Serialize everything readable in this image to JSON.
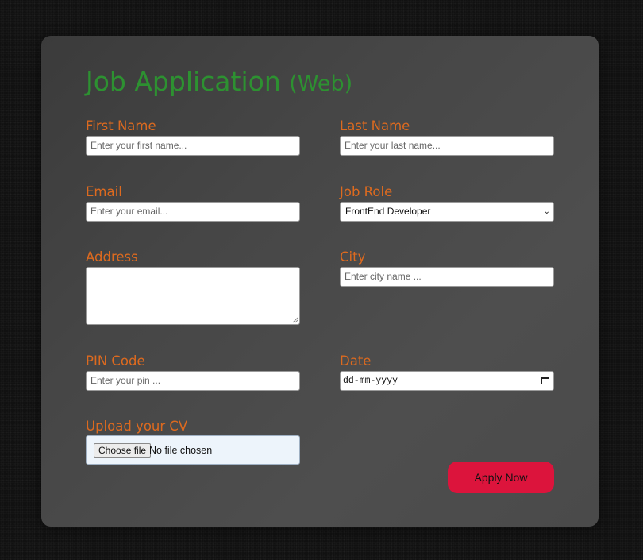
{
  "form": {
    "title": "Job Application",
    "title_suffix": "(Web)",
    "first_name": {
      "label": "First Name",
      "placeholder": "Enter your first name..."
    },
    "last_name": {
      "label": "Last Name",
      "placeholder": "Enter your last name..."
    },
    "email": {
      "label": "Email",
      "placeholder": "Enter your email..."
    },
    "job_role": {
      "label": "Job Role",
      "selected": "FrontEnd Developer"
    },
    "address": {
      "label": "Address",
      "value": ""
    },
    "city": {
      "label": "City",
      "placeholder": "Enter city name ..."
    },
    "pin_code": {
      "label": "PIN Code",
      "placeholder": "Enter your pin ..."
    },
    "date": {
      "label": "Date",
      "placeholder": "dd-mm-yyyy"
    },
    "upload": {
      "label": "Upload your CV",
      "button": "Choose file",
      "status": "No file chosen"
    },
    "apply_button": "Apply Now"
  },
  "colors": {
    "title": "#2d9131",
    "labels": "#dd6a1f",
    "apply_button": "#dc143c",
    "upload_bg": "#edf4fb"
  },
  "icons": {
    "select_arrow": "chevron-down-icon",
    "date_picker": "calendar-icon",
    "textarea_resize": "resize-grip-icon"
  }
}
